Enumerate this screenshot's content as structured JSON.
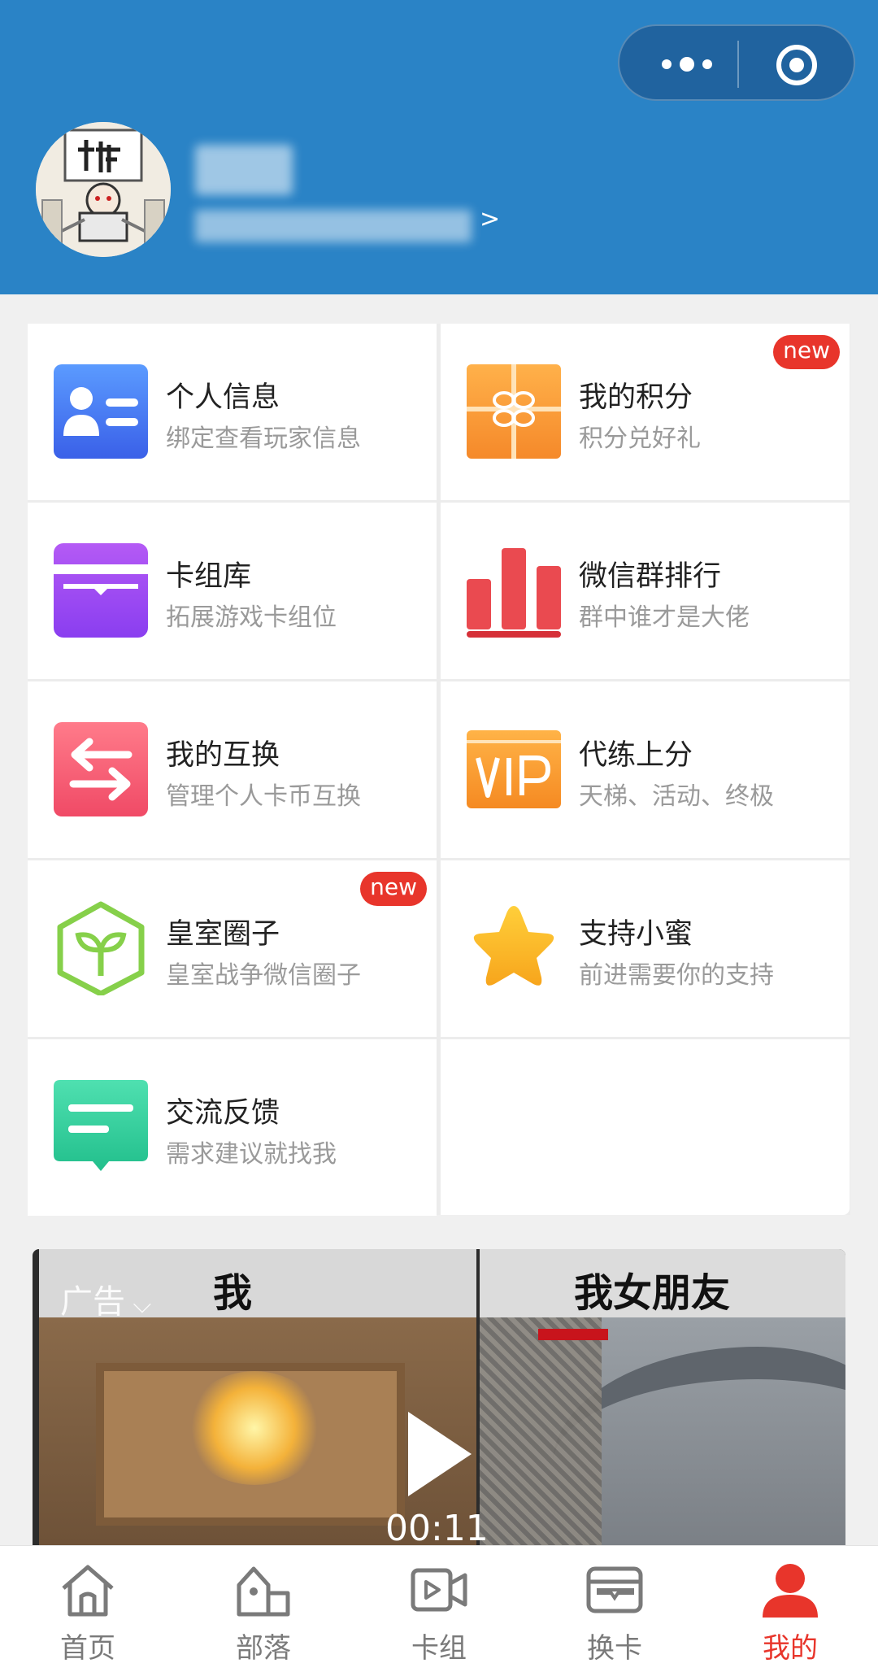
{
  "header": {
    "more_icon": "more-dots-icon",
    "close_icon": "target-circle-icon",
    "profile_arrow": ">"
  },
  "grid": {
    "items": [
      {
        "title": "个人信息",
        "sub": "绑定查看玩家信息",
        "icon": "id-card-icon",
        "color": "#4a7bf0"
      },
      {
        "title": "我的积分",
        "sub": "积分兑好礼",
        "icon": "gift-icon",
        "color": "#f7a13a",
        "badge": "new"
      },
      {
        "title": "卡组库",
        "sub": "拓展游戏卡组位",
        "icon": "card-wallet-icon",
        "color": "#9b4cf0"
      },
      {
        "title": "微信群排行",
        "sub": "群中谁才是大佬",
        "icon": "bar-chart-icon",
        "color": "#e8424a"
      },
      {
        "title": "我的互换",
        "sub": "管理个人卡币互换",
        "icon": "swap-icon",
        "color": "#f4566e"
      },
      {
        "title": "代练上分",
        "sub": "天梯、活动、终极",
        "icon": "vip-icon",
        "color": "#f59a2e"
      },
      {
        "title": "皇室圈子",
        "sub": "皇室战争微信圈子",
        "icon": "sprout-box-icon",
        "color": "#86d04a",
        "badge": "new"
      },
      {
        "title": "支持小蜜",
        "sub": "前进需要你的支持",
        "icon": "star-icon",
        "color": "#f7b52c"
      },
      {
        "title": "交流反馈",
        "sub": "需求建议就找我",
        "icon": "chat-bubble-icon",
        "color": "#2ec99a"
      }
    ]
  },
  "ad": {
    "label": "广告",
    "caption_left": "我",
    "caption_right": "我女朋友",
    "duration": "00:11"
  },
  "tabbar": {
    "tabs": [
      {
        "label": "首页",
        "icon": "home-icon"
      },
      {
        "label": "部落",
        "icon": "tribe-house-icon"
      },
      {
        "label": "卡组",
        "icon": "video-card-icon"
      },
      {
        "label": "换卡",
        "icon": "wallet-icon"
      },
      {
        "label": "我的",
        "icon": "person-icon",
        "active": true
      }
    ]
  }
}
